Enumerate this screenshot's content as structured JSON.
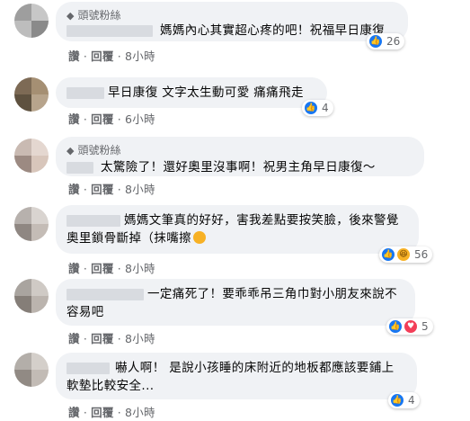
{
  "actions": {
    "like_label": "讚",
    "reply_label": "回覆",
    "separator": "·"
  },
  "icons": {
    "badge": "diamond-icon",
    "like": "thumbs-up-icon",
    "haha": "laughing-face-icon",
    "love": "heart-icon"
  },
  "colors": {
    "bubble": "#f0f2f5",
    "like_blue": "#1877f2",
    "love_red": "#f33e58",
    "haha_yellow": "#f7b125",
    "meta_gray": "#65676b"
  },
  "comments": [
    {
      "badge": "頭號粉絲",
      "text_line1": "媽媽內心其實超心疼的吧！祝福早日康復",
      "text_line2": "",
      "time": "8小時",
      "reaction_count": "26"
    },
    {
      "badge": "",
      "text_line1": "早日康復 文字太生動可愛 痛痛飛走",
      "text_line2": "",
      "time": "6小時",
      "reaction_count": "4"
    },
    {
      "badge": "頭號粉絲",
      "text_line1": "太驚險了！還好奧里沒事啊！祝男主角早日康復～",
      "text_line2": "",
      "time": "8小時",
      "reaction_count": ""
    },
    {
      "badge": "",
      "text_line1": "媽媽文筆真的好好，害我差點要按笑臉，後來警覺",
      "text_line2": "奧里鎖骨斷掉（抹嘴擦",
      "time": "8小時",
      "reaction_count": "56"
    },
    {
      "badge": "",
      "text_line1": "一定痛死了！要乖乖吊三角巾對小朋友來說不",
      "text_line2": "容易吧",
      "time": "8小時",
      "reaction_count": "5"
    },
    {
      "badge": "",
      "text_line1": "嚇人啊！ 是說小孩睡的床附近的地板都應該要鋪上",
      "text_line2": "軟墊比較安全...",
      "time": "8小時",
      "reaction_count": "4"
    }
  ]
}
